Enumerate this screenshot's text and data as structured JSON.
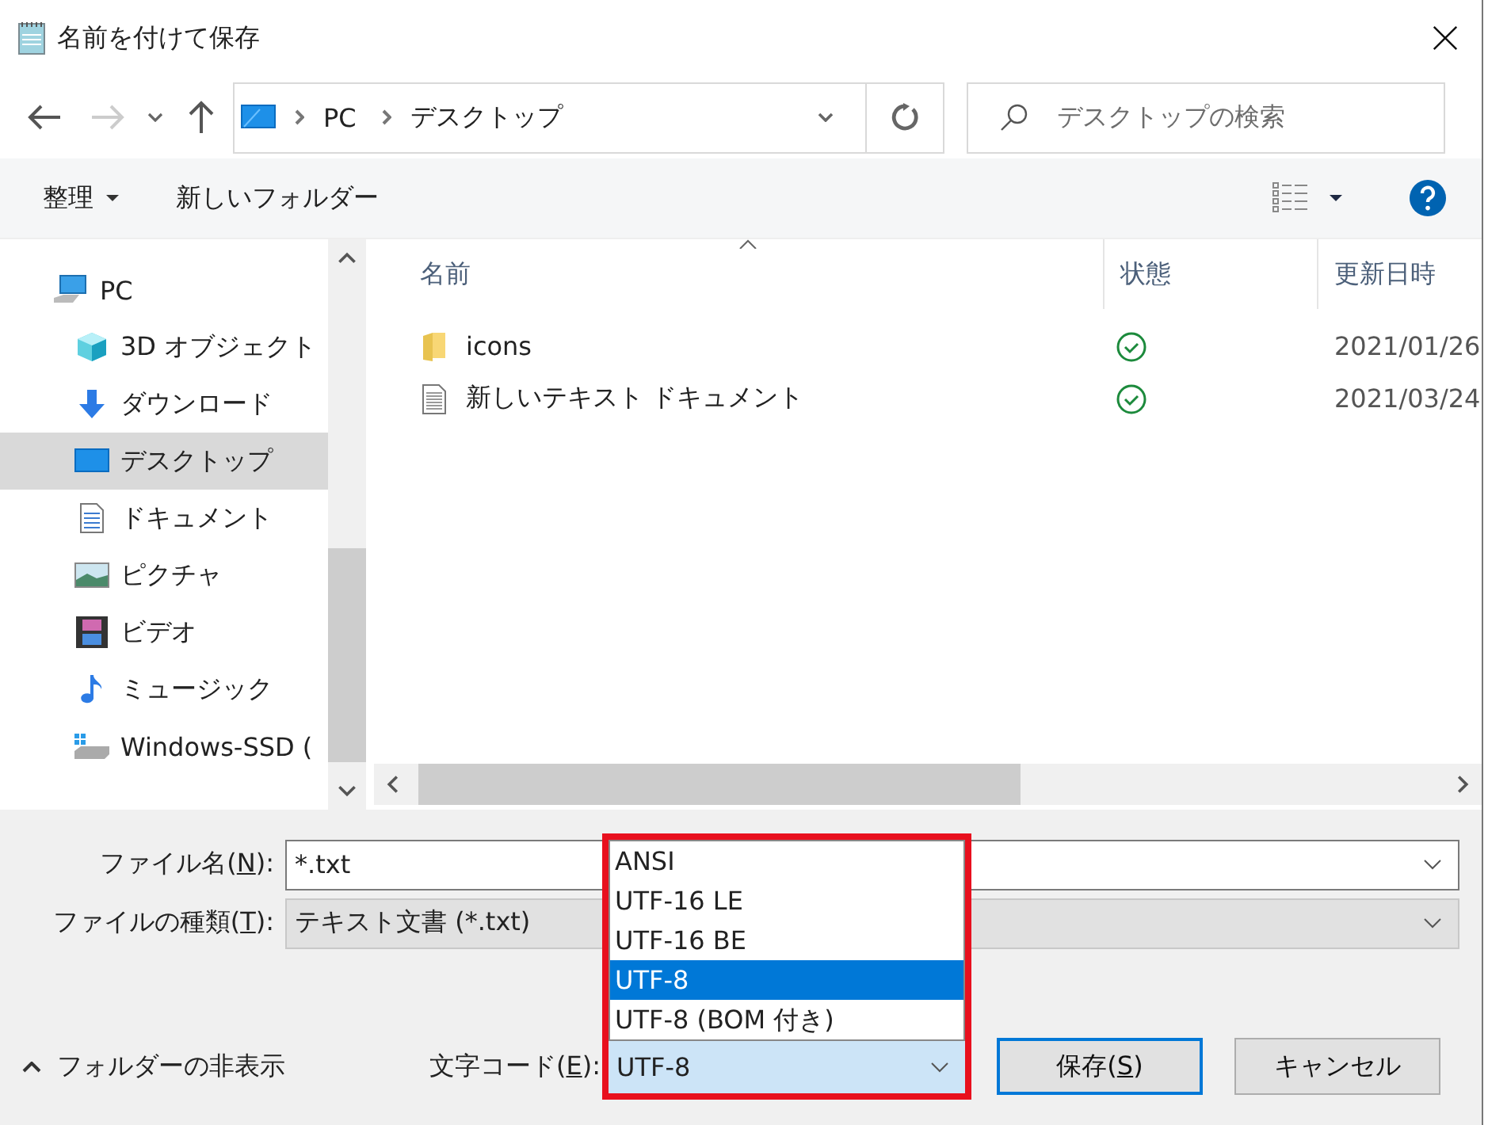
{
  "window": {
    "title": "名前を付けて保存"
  },
  "address": {
    "segments": [
      "PC",
      "デスクトップ"
    ]
  },
  "search": {
    "placeholder": "デスクトップの検索"
  },
  "toolbar": {
    "organize": "整理",
    "new_folder": "新しいフォルダー"
  },
  "sidebar": {
    "items": [
      {
        "label": "PC",
        "kind": "pc",
        "selected": false,
        "children": [
          {
            "label": "3D オブジェクト",
            "kind": "cube",
            "selected": false
          },
          {
            "label": "ダウンロード",
            "kind": "download",
            "selected": false
          },
          {
            "label": "デスクトップ",
            "kind": "desktop",
            "selected": true
          },
          {
            "label": "ドキュメント",
            "kind": "document",
            "selected": false
          },
          {
            "label": "ピクチャ",
            "kind": "picture",
            "selected": false
          },
          {
            "label": "ビデオ",
            "kind": "video",
            "selected": false
          },
          {
            "label": "ミュージック",
            "kind": "music",
            "selected": false
          },
          {
            "label": "Windows-SSD (",
            "kind": "drive",
            "selected": false
          }
        ]
      }
    ]
  },
  "table": {
    "columns": [
      {
        "label": "名前",
        "sorted": true
      },
      {
        "label": "状態",
        "sorted": false
      },
      {
        "label": "更新日時",
        "sorted": false
      }
    ],
    "rows": [
      {
        "kind": "folder",
        "name": "icons",
        "synced": true,
        "date": "2021/01/26"
      },
      {
        "kind": "text",
        "name": "新しいテキスト ドキュメント",
        "synced": true,
        "date": "2021/03/24"
      }
    ]
  },
  "file_name": {
    "label": "ファイル名(",
    "mnemonic": "N",
    "suffix": "):",
    "value": "*.txt"
  },
  "file_type": {
    "label": "ファイルの種類(",
    "mnemonic": "T",
    "suffix": "):",
    "value": "テキスト文書 (*.txt)"
  },
  "encoding": {
    "label": "文字コード(",
    "mnemonic": "E",
    "suffix": "):",
    "value": "UTF-8",
    "highlighted": true,
    "options": [
      {
        "label": "ANSI",
        "selected": false
      },
      {
        "label": "UTF-16 LE",
        "selected": false
      },
      {
        "label": "UTF-16 BE",
        "selected": false
      },
      {
        "label": "UTF-8",
        "selected": true
      },
      {
        "label": "UTF-8 (BOM 付き)",
        "selected": false
      }
    ]
  },
  "hide_folders": "フォルダーの非表示",
  "buttons": [
    {
      "label": "保存(",
      "mnemonic": "S",
      "suffix": ")",
      "default": true
    },
    {
      "label": "キャンセル",
      "default": false
    }
  ]
}
